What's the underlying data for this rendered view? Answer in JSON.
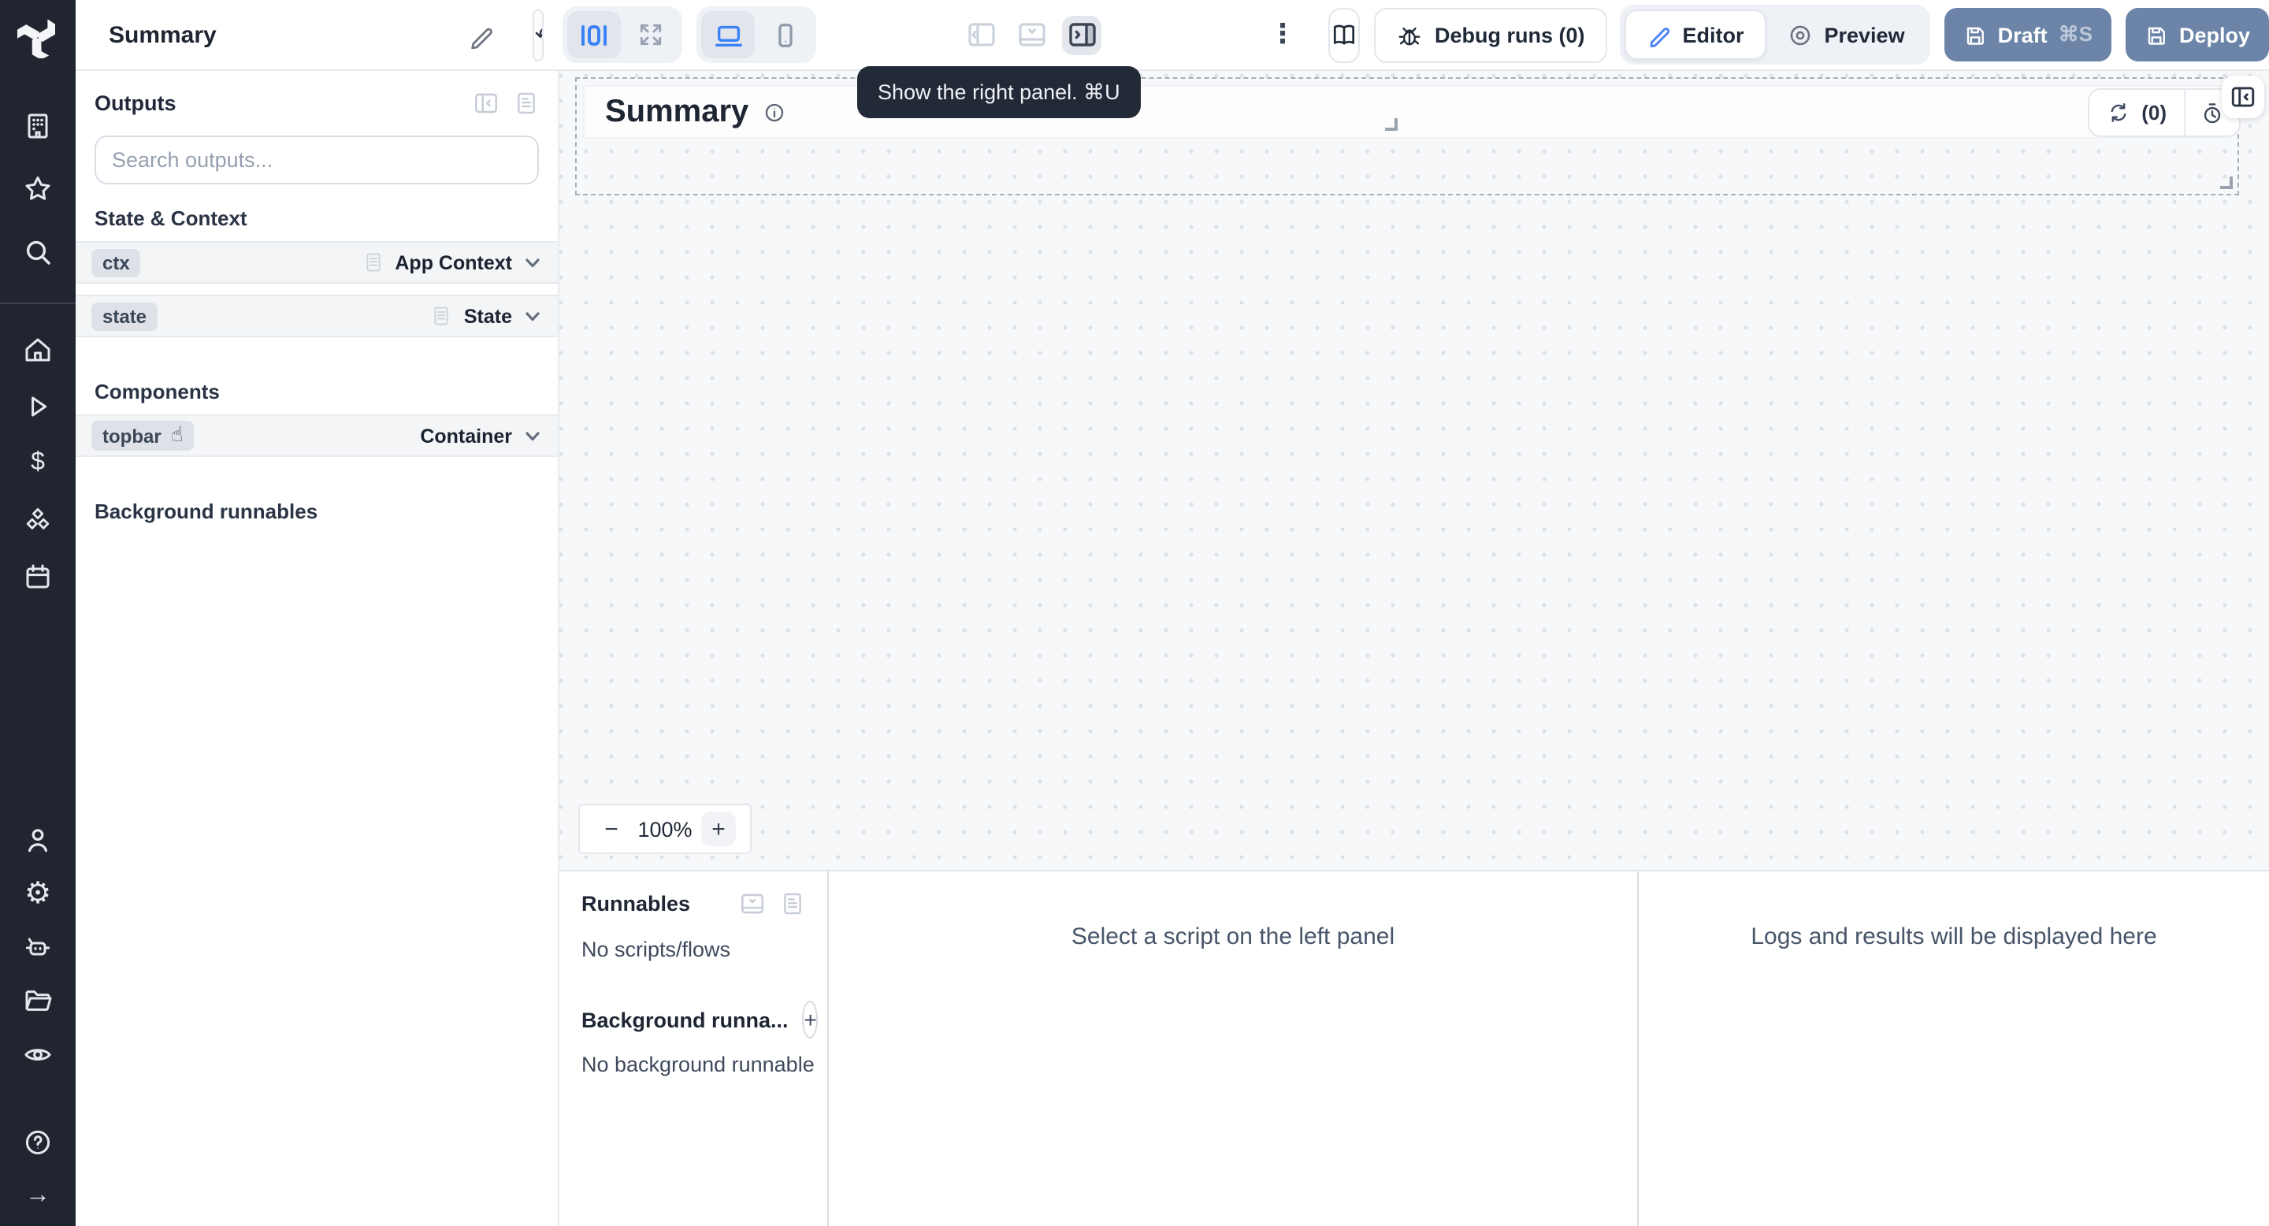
{
  "topbar": {
    "title": "Summary",
    "debug_runs": "Debug runs (0)",
    "editor": "Editor",
    "preview": "Preview",
    "draft": "Draft",
    "draft_shortcut": "⌘S",
    "deploy": "Deploy"
  },
  "tooltip": "Show the right panel. ⌘U",
  "outputs_panel": {
    "title": "Outputs",
    "search_placeholder": "Search outputs...",
    "state_context_header": "State & Context",
    "state_rows": [
      {
        "badge": "ctx",
        "type": "App Context"
      },
      {
        "badge": "state",
        "type": "State"
      }
    ],
    "components_header": "Components",
    "component_rows": [
      {
        "badge": "topbar",
        "type": "Container"
      }
    ],
    "background_header": "Background runnables"
  },
  "canvas": {
    "heading": "Summary",
    "refresh_count": "(0)",
    "zoom_out": "−",
    "zoom_level": "100%",
    "zoom_in": "+"
  },
  "bottom_panel": {
    "runnables_title": "Runnables",
    "no_scripts": "No scripts/flows",
    "background_title": "Background runna...",
    "add_button": "+",
    "no_background": "No background runnable",
    "script_placeholder": "Select a script on the left panel",
    "logs_placeholder": "Logs and results will be displayed here"
  },
  "glyphs": {
    "undo": "↶",
    "redo": "↷",
    "kebab": "⋮",
    "dollar": "$",
    "gear": "⚙",
    "question": "?",
    "arrow_right": "→",
    "hand_cursor": "☝"
  },
  "colors": {
    "accent_blue": "#3b82f6",
    "primary_button": "#6c84a8",
    "sidebar_bg": "#21252f",
    "tooltip_bg": "#232a37",
    "canvas_bg": "#f7f8fa"
  }
}
